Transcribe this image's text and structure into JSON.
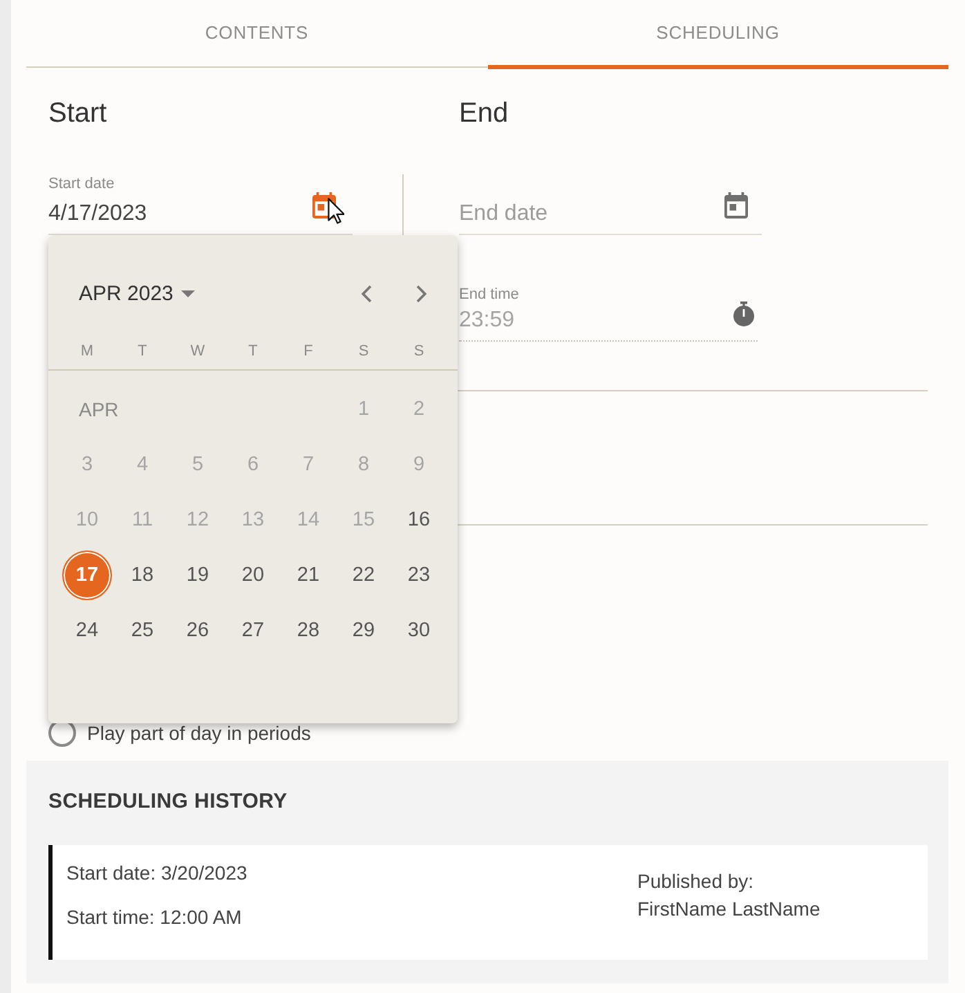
{
  "tabs": [
    {
      "label": "CONTENTS",
      "selected": false
    },
    {
      "label": "SCHEDULING",
      "selected": true
    }
  ],
  "start": {
    "heading": "Start",
    "date_field": {
      "label": "Start date",
      "value": "4/17/2023",
      "active": true
    }
  },
  "end": {
    "heading": "End",
    "date_field": {
      "placeholder": "End date",
      "active": false
    },
    "time_field": {
      "label": "End time",
      "value": "23:59",
      "disabled": true
    }
  },
  "calendar": {
    "month_button": "APR 2023",
    "weekdays": [
      "M",
      "T",
      "W",
      "T",
      "F",
      "S",
      "S"
    ],
    "month_label": "APR",
    "weeks": [
      {
        "days": [
          {
            "label": "1",
            "disabled": true,
            "selected": false
          },
          {
            "label": "2",
            "disabled": true,
            "selected": false
          }
        ]
      },
      {
        "days": [
          {
            "label": "3",
            "disabled": true,
            "selected": false
          },
          {
            "label": "4",
            "disabled": true,
            "selected": false
          },
          {
            "label": "5",
            "disabled": true,
            "selected": false
          },
          {
            "label": "6",
            "disabled": true,
            "selected": false
          },
          {
            "label": "7",
            "disabled": true,
            "selected": false
          },
          {
            "label": "8",
            "disabled": true,
            "selected": false
          },
          {
            "label": "9",
            "disabled": true,
            "selected": false
          }
        ]
      },
      {
        "days": [
          {
            "label": "10",
            "disabled": true,
            "selected": false
          },
          {
            "label": "11",
            "disabled": true,
            "selected": false
          },
          {
            "label": "12",
            "disabled": true,
            "selected": false
          },
          {
            "label": "13",
            "disabled": true,
            "selected": false
          },
          {
            "label": "14",
            "disabled": true,
            "selected": false
          },
          {
            "label": "15",
            "disabled": true,
            "selected": false
          },
          {
            "label": "16",
            "disabled": false,
            "selected": false
          }
        ]
      },
      {
        "days": [
          {
            "label": "17",
            "disabled": false,
            "selected": true
          },
          {
            "label": "18",
            "disabled": false,
            "selected": false
          },
          {
            "label": "19",
            "disabled": false,
            "selected": false
          },
          {
            "label": "20",
            "disabled": false,
            "selected": false
          },
          {
            "label": "21",
            "disabled": false,
            "selected": false
          },
          {
            "label": "22",
            "disabled": false,
            "selected": false
          },
          {
            "label": "23",
            "disabled": false,
            "selected": false
          }
        ]
      },
      {
        "days": [
          {
            "label": "24",
            "disabled": false,
            "selected": false
          },
          {
            "label": "25",
            "disabled": false,
            "selected": false
          },
          {
            "label": "26",
            "disabled": false,
            "selected": false
          },
          {
            "label": "27",
            "disabled": false,
            "selected": false
          },
          {
            "label": "28",
            "disabled": false,
            "selected": false
          },
          {
            "label": "29",
            "disabled": false,
            "selected": false
          },
          {
            "label": "30",
            "disabled": false,
            "selected": false
          }
        ]
      }
    ]
  },
  "radio_option": {
    "label": "Play part of day in periods",
    "checked": false
  },
  "scheduling_history": {
    "title": "SCHEDULING HISTORY",
    "entries": [
      {
        "start_date": "Start date: 3/20/2023",
        "start_time": "Start time: 12:00 AM",
        "published_by_label": "Published by:",
        "published_by": "FirstName LastName"
      }
    ]
  }
}
